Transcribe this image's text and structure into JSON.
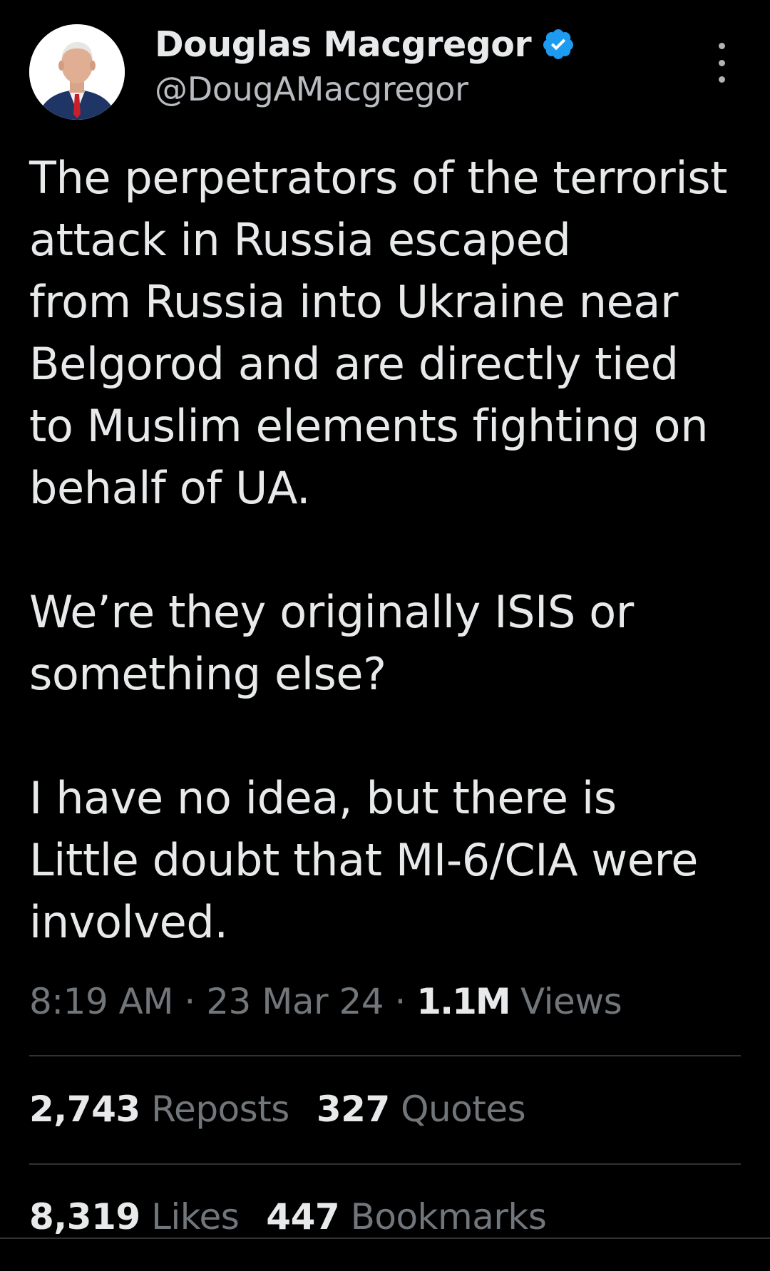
{
  "author": {
    "display_name": "Douglas Macgregor",
    "handle": "@DougAMacgregor",
    "verified_icon": "verified-badge-icon",
    "verified_color": "#1d9bf0"
  },
  "tweet": {
    "paragraphs": [
      "The perpetrators of the terrorist\nattack in Russia escaped\nfrom Russia into Ukraine near\nBelgorod and are directly tied\nto Muslim elements fighting on\nbehalf of UA.",
      "We’re they originally ISIS or\nsomething else?",
      "I have no idea, but there is\nLittle doubt that MI-6/CIA were\ninvolved."
    ]
  },
  "meta": {
    "time": "8:19 AM",
    "separator": " · ",
    "date": "23 Mar 24",
    "views_count": "1.1M",
    "views_label": "Views"
  },
  "stats": {
    "reposts_count": "2,743",
    "reposts_label": "Reposts",
    "quotes_count": "327",
    "quotes_label": "Quotes",
    "likes_count": "8,319",
    "likes_label": "Likes",
    "bookmarks_count": "447",
    "bookmarks_label": "Bookmarks"
  },
  "colors": {
    "background": "#000000",
    "text": "#e7e9ea",
    "secondary": "#71767b",
    "divider": "#2f3336"
  }
}
